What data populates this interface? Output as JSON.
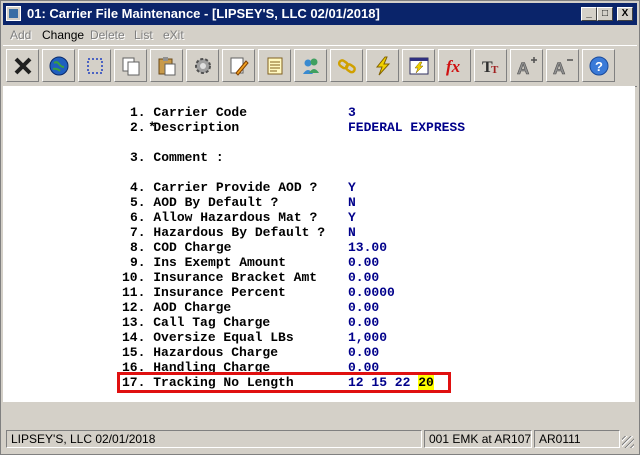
{
  "window": {
    "title": "01: Carrier File Maintenance - [LIPSEY'S, LLC 02/01/2018]",
    "controls": {
      "minimize": "_",
      "maximize": "□",
      "close": "X"
    }
  },
  "menu": [
    {
      "label": "Add",
      "enabled": false
    },
    {
      "label": "Change",
      "enabled": true
    },
    {
      "label": "Delete",
      "enabled": false
    },
    {
      "label": "List",
      "enabled": false
    },
    {
      "label": "eXit",
      "enabled": false
    }
  ],
  "toolbar": [
    {
      "icon": "exit-x-icon"
    },
    {
      "icon": "globe-icon"
    },
    {
      "icon": "select-box-icon"
    },
    {
      "icon": "copy-icon"
    },
    {
      "icon": "paste-icon"
    },
    {
      "icon": "settings-gear-icon"
    },
    {
      "icon": "edit-pencil-icon"
    },
    {
      "icon": "notes-icon"
    },
    {
      "icon": "users-icon"
    },
    {
      "icon": "link-chain-icon"
    },
    {
      "icon": "lightning-icon"
    },
    {
      "icon": "window-lightning-icon"
    },
    {
      "icon": "function-fx-icon"
    },
    {
      "icon": "font-size-icon"
    },
    {
      "icon": "increase-font-icon"
    },
    {
      "icon": "decrease-font-icon"
    },
    {
      "icon": "help-icon"
    }
  ],
  "fields": [
    {
      "marker": "*",
      "num": "1.",
      "label": "Carrier Code",
      "value": "3"
    },
    {
      "marker": "",
      "num": "2.",
      "label": "Description",
      "value": "FEDERAL EXPRESS"
    },
    {
      "marker": "",
      "num": "3.",
      "label": "Comment :",
      "value": ""
    },
    {
      "marker": "",
      "num": "4.",
      "label": "Carrier Provide AOD ?",
      "value": "Y"
    },
    {
      "marker": "",
      "num": "5.",
      "label": "AOD By Default ?",
      "value": "N"
    },
    {
      "marker": "",
      "num": "6.",
      "label": "Allow Hazardous Mat ?",
      "value": "Y"
    },
    {
      "marker": "",
      "num": "7.",
      "label": "Hazardous By Default ?",
      "value": "N"
    },
    {
      "marker": "",
      "num": "8.",
      "label": "COD Charge",
      "value": "13.00"
    },
    {
      "marker": "",
      "num": "9.",
      "label": "Ins Exempt Amount",
      "value": "0.00"
    },
    {
      "marker": "",
      "num": "10.",
      "label": "Insurance Bracket Amt",
      "value": "0.00"
    },
    {
      "marker": "",
      "num": "11.",
      "label": "Insurance Percent",
      "value": "0.0000"
    },
    {
      "marker": "",
      "num": "12.",
      "label": "AOD Charge",
      "value": "0.00"
    },
    {
      "marker": "",
      "num": "13.",
      "label": "Call Tag Charge",
      "value": "0.00"
    },
    {
      "marker": "",
      "num": "14.",
      "label": "Oversize Equal LBs",
      "value": "1,000"
    },
    {
      "marker": "",
      "num": "15.",
      "label": "Hazardous Charge",
      "value": "0.00"
    },
    {
      "marker": "",
      "num": "16.",
      "label": "Handling Charge",
      "value": "0.00"
    },
    {
      "marker": "",
      "num": "17.",
      "label": "Tracking No Length",
      "value": "12 15 22",
      "active_value": "20"
    }
  ],
  "status": {
    "company": "LIPSEY'S, LLC 02/01/2018",
    "session": "001 EMK at AR107",
    "program": "AR0111"
  },
  "colors": {
    "title_bar": "#0a246a",
    "value_text": "#00008b",
    "highlight_border": "#e01010",
    "active_field": "#ffff00"
  }
}
